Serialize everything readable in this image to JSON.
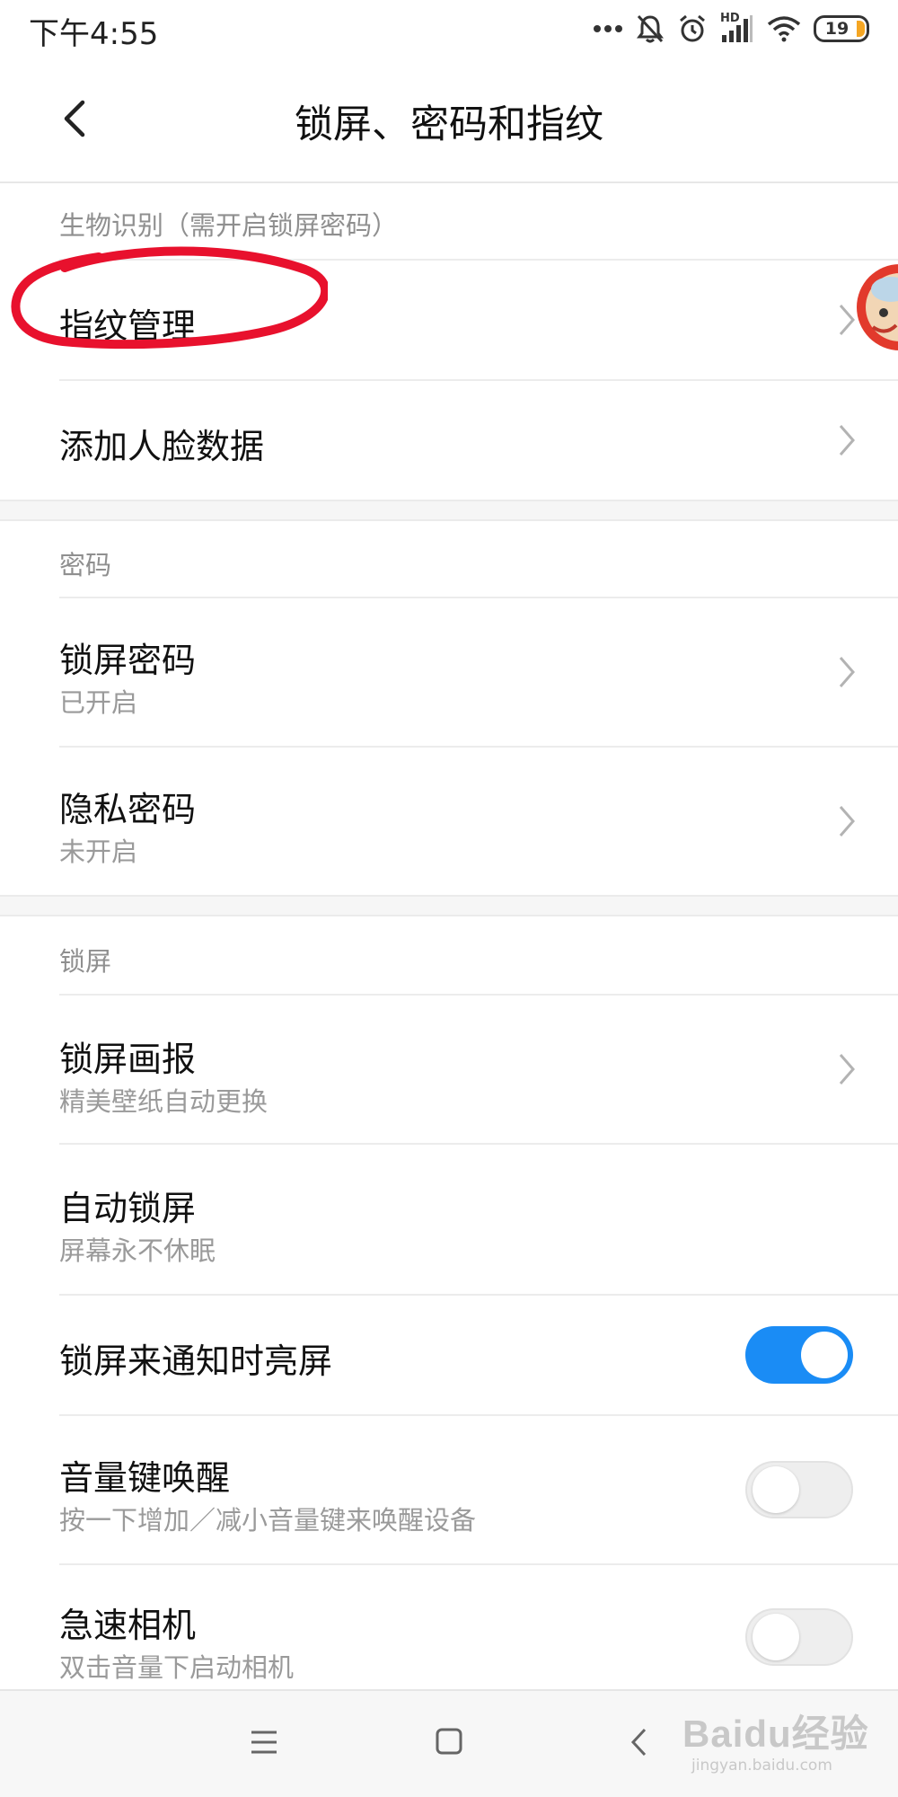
{
  "status_bar": {
    "time": "下午4:55",
    "network_label": "HD",
    "battery_level": "19",
    "battery_color": "#f5a623",
    "icons": [
      "more-dots-icon",
      "mute-bell-icon",
      "alarm-icon",
      "signal-icon",
      "wifi-icon",
      "battery-icon"
    ]
  },
  "header": {
    "title": "锁屏、密码和指纹",
    "back_icon": "back-arrow-icon"
  },
  "sections": {
    "biometrics": {
      "header": "生物识别（需开启锁屏密码）",
      "items": [
        {
          "title": "指纹管理"
        },
        {
          "title": "添加人脸数据"
        }
      ]
    },
    "password": {
      "header": "密码",
      "items": [
        {
          "title": "锁屏密码",
          "subtitle": "已开启"
        },
        {
          "title": "隐私密码",
          "subtitle": "未开启"
        }
      ]
    },
    "lockscreen": {
      "header": "锁屏",
      "items": [
        {
          "title": "锁屏画报",
          "subtitle": "精美壁纸自动更换"
        },
        {
          "title": "自动锁屏",
          "subtitle": "屏幕永不休眠"
        },
        {
          "title": "锁屏来通知时亮屏",
          "toggle": true
        },
        {
          "title": "音量键唤醒",
          "subtitle": "按一下增加／减小音量键来唤醒设备",
          "toggle": false
        },
        {
          "title": "急速相机",
          "subtitle": "双击音量下启动相机",
          "toggle": false
        }
      ]
    }
  },
  "colors": {
    "accent": "#1a8cf5",
    "annotation_circle": "#e8112d"
  },
  "nav_bar": {
    "icons": [
      "menu-icon",
      "home-icon",
      "back-icon"
    ]
  },
  "watermark": {
    "brand": "Baidu经验",
    "url": "jingyan.baidu.com"
  }
}
